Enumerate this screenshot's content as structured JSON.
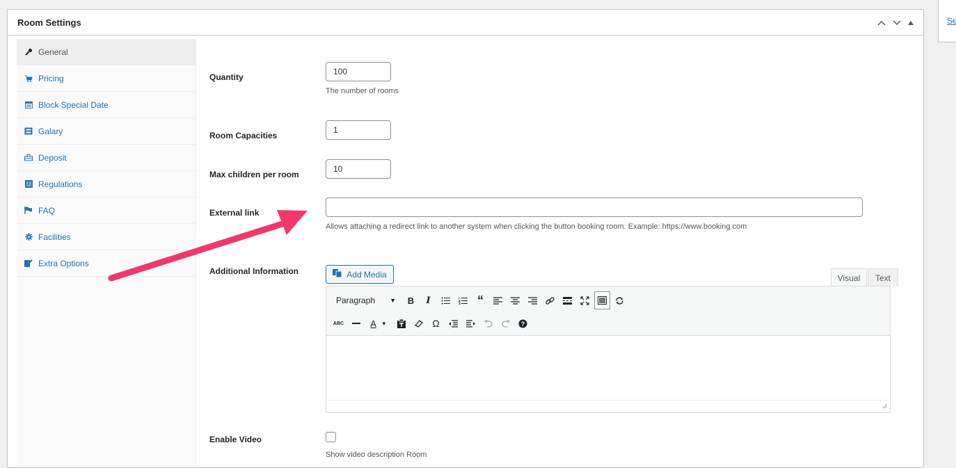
{
  "panel": {
    "title": "Room Settings",
    "controls": [
      "move-up",
      "move-down",
      "toggle"
    ]
  },
  "side": {
    "link_text": "Se"
  },
  "tabs": [
    {
      "label": "General",
      "icon": "wrench-icon",
      "active": true
    },
    {
      "label": "Pricing",
      "icon": "cart-icon"
    },
    {
      "label": "Block Special Date",
      "icon": "calendar-icon"
    },
    {
      "label": "Galary",
      "icon": "gallery-icon"
    },
    {
      "label": "Deposit",
      "icon": "money-icon"
    },
    {
      "label": "Regulations",
      "icon": "regulations-icon"
    },
    {
      "label": "FAQ",
      "icon": "flag-icon"
    },
    {
      "label": "Facilities",
      "icon": "gear-icon"
    },
    {
      "label": "Extra Options",
      "icon": "edit-icon"
    }
  ],
  "fields": {
    "quantity": {
      "label": "Quantity",
      "value": "100",
      "desc": "The number of rooms"
    },
    "capacities": {
      "label": "Room Capacities",
      "value": "1"
    },
    "max_children": {
      "label": "Max children per room",
      "value": "10"
    },
    "external_link": {
      "label": "External link",
      "value": "",
      "desc": "Allows attaching a redirect link to another system when clicking the button booking room. Example: https://www.booking.com"
    },
    "additional_info": {
      "label": "Additional Information",
      "add_media": "Add Media",
      "mode_visual": "Visual",
      "mode_text": "Text",
      "format": "Paragraph"
    },
    "enable_video": {
      "label": "Enable Video",
      "checked": false,
      "desc": "Show video description Room"
    }
  },
  "colors": {
    "accent": "#2271b1",
    "annotation_arrow": "#f0386b"
  }
}
